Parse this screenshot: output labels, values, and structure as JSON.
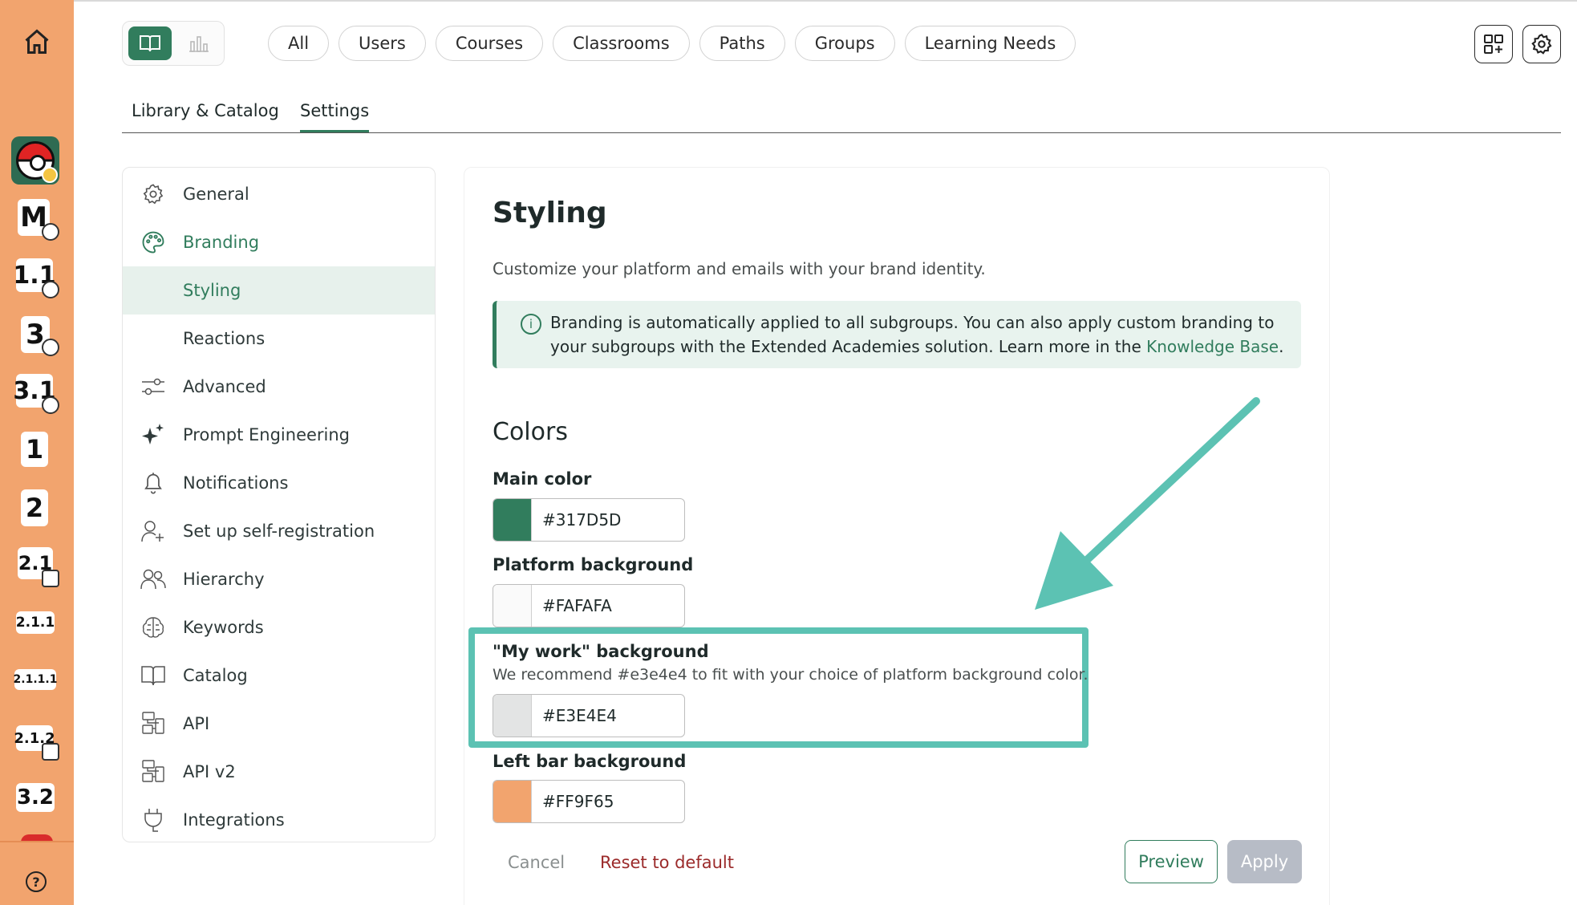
{
  "rail": {
    "chips": [
      "M",
      "1.1",
      "3",
      "3.1",
      "1",
      "2",
      "2.1",
      "2.1.1",
      "2.1.1.1",
      "2.1.2",
      "3.2"
    ],
    "help": "?"
  },
  "top_pills": [
    "All",
    "Users",
    "Courses",
    "Classrooms",
    "Paths",
    "Groups",
    "Learning Needs"
  ],
  "tabs": [
    "Library & Catalog",
    "Settings"
  ],
  "sidebar": {
    "items": [
      {
        "label": "General",
        "icon": "gear-icon"
      },
      {
        "label": "Branding",
        "icon": "palette-icon"
      },
      {
        "label": "Styling",
        "icon": ""
      },
      {
        "label": "Reactions",
        "icon": ""
      },
      {
        "label": "Advanced",
        "icon": "sliders-icon"
      },
      {
        "label": "Prompt Engineering",
        "icon": "sparkle-icon"
      },
      {
        "label": "Notifications",
        "icon": "bell-icon"
      },
      {
        "label": "Set up self-registration",
        "icon": "add-user-icon"
      },
      {
        "label": "Hierarchy",
        "icon": "users-icon"
      },
      {
        "label": "Keywords",
        "icon": "brain-icon"
      },
      {
        "label": "Catalog",
        "icon": "book-icon"
      },
      {
        "label": "API",
        "icon": "api-icon"
      },
      {
        "label": "API v2",
        "icon": "api-icon"
      },
      {
        "label": "Integrations",
        "icon": "plug-icon"
      }
    ]
  },
  "main": {
    "title": "Styling",
    "subtitle": "Customize your platform and emails with your brand identity.",
    "info": {
      "text": "Branding is automatically applied to all subgroups. You can also apply custom branding to your subgroups with the Extended Academies solution. Learn more in the ",
      "link": "Knowledge Base",
      "after": "."
    },
    "colors_heading": "Colors",
    "fields": [
      {
        "label": "Main color",
        "value": "#317D5D",
        "swatch": "#317D5D",
        "desc": ""
      },
      {
        "label": "Platform background",
        "value": "#FAFAFA",
        "swatch": "#FAFAFA",
        "desc": ""
      },
      {
        "label": "\"My work\" background",
        "value": "#E3E4E4",
        "swatch": "#E3E4E4",
        "desc": "We recommend #e3e4e4 to fit with your choice of platform background color."
      },
      {
        "label": "Left bar background",
        "value": "#FF9F65",
        "swatch": "#F2A46E",
        "desc": ""
      }
    ],
    "buttons": {
      "cancel": "Cancel",
      "reset": "Reset to default",
      "preview": "Preview",
      "apply": "Apply"
    }
  },
  "colors": {
    "accent": "#317D5D",
    "rail": "#F2A46E",
    "highlight": "#5cc2b3"
  }
}
